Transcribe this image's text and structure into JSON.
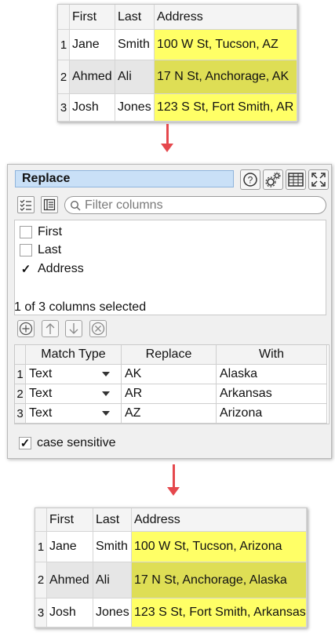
{
  "top_table": {
    "headers": [
      "",
      "First",
      "Last",
      "Address"
    ],
    "rows": [
      {
        "num": "1",
        "first": "Jane",
        "last": "Smith",
        "address": "100 W St, Tucson, AZ"
      },
      {
        "num": "2",
        "first": "Ahmed",
        "last": "Ali",
        "address": "17 N St, Anchorage, AK"
      },
      {
        "num": "3",
        "first": "Josh",
        "last": "Jones",
        "address": "123 S St, Fort Smith, AR"
      }
    ]
  },
  "panel": {
    "title": "Replace",
    "filter_placeholder": "Filter columns",
    "columns": [
      {
        "label": "First",
        "checked": false
      },
      {
        "label": "Last",
        "checked": false
      },
      {
        "label": "Address",
        "checked": true
      }
    ],
    "status": "1 of 3 columns selected",
    "grid": {
      "headers": [
        "",
        "Match Type",
        "Replace",
        "With"
      ],
      "rows": [
        {
          "num": "1",
          "match": "Text",
          "replace": "AK",
          "with": "Alaska"
        },
        {
          "num": "2",
          "match": "Text",
          "replace": "AR",
          "with": "Arkansas"
        },
        {
          "num": "3",
          "match": "Text",
          "replace": "AZ",
          "with": "Arizona"
        }
      ]
    },
    "case_sensitive_label": "case sensitive",
    "case_sensitive_checked": true
  },
  "bottom_table": {
    "headers": [
      "",
      "First",
      "Last",
      "Address"
    ],
    "rows": [
      {
        "num": "1",
        "first": "Jane",
        "last": "Smith",
        "address": "100 W St, Tucson, Arizona"
      },
      {
        "num": "2",
        "first": "Ahmed",
        "last": "Ali",
        "address": "17 N St, Anchorage, Alaska"
      },
      {
        "num": "3",
        "first": "Josh",
        "last": "Jones",
        "address": "123 S St, Fort Smith, Arkansas"
      }
    ]
  },
  "icons": {
    "help": "help-icon",
    "settings": "gears-icon",
    "table": "table-icon",
    "expand": "expand-icon",
    "check_all": "check-list-icon",
    "uncheck_all": "list-icon",
    "search": "search-icon",
    "add": "add-icon",
    "up": "arrow-up-icon",
    "down": "arrow-down-icon",
    "remove": "remove-icon",
    "dropdown": "chevron-down-icon"
  },
  "colors": {
    "highlight": "#ffff66",
    "highlight_selected": "#dede55",
    "arrow": "#e5484d",
    "title_bar": "#c9e0f7"
  }
}
